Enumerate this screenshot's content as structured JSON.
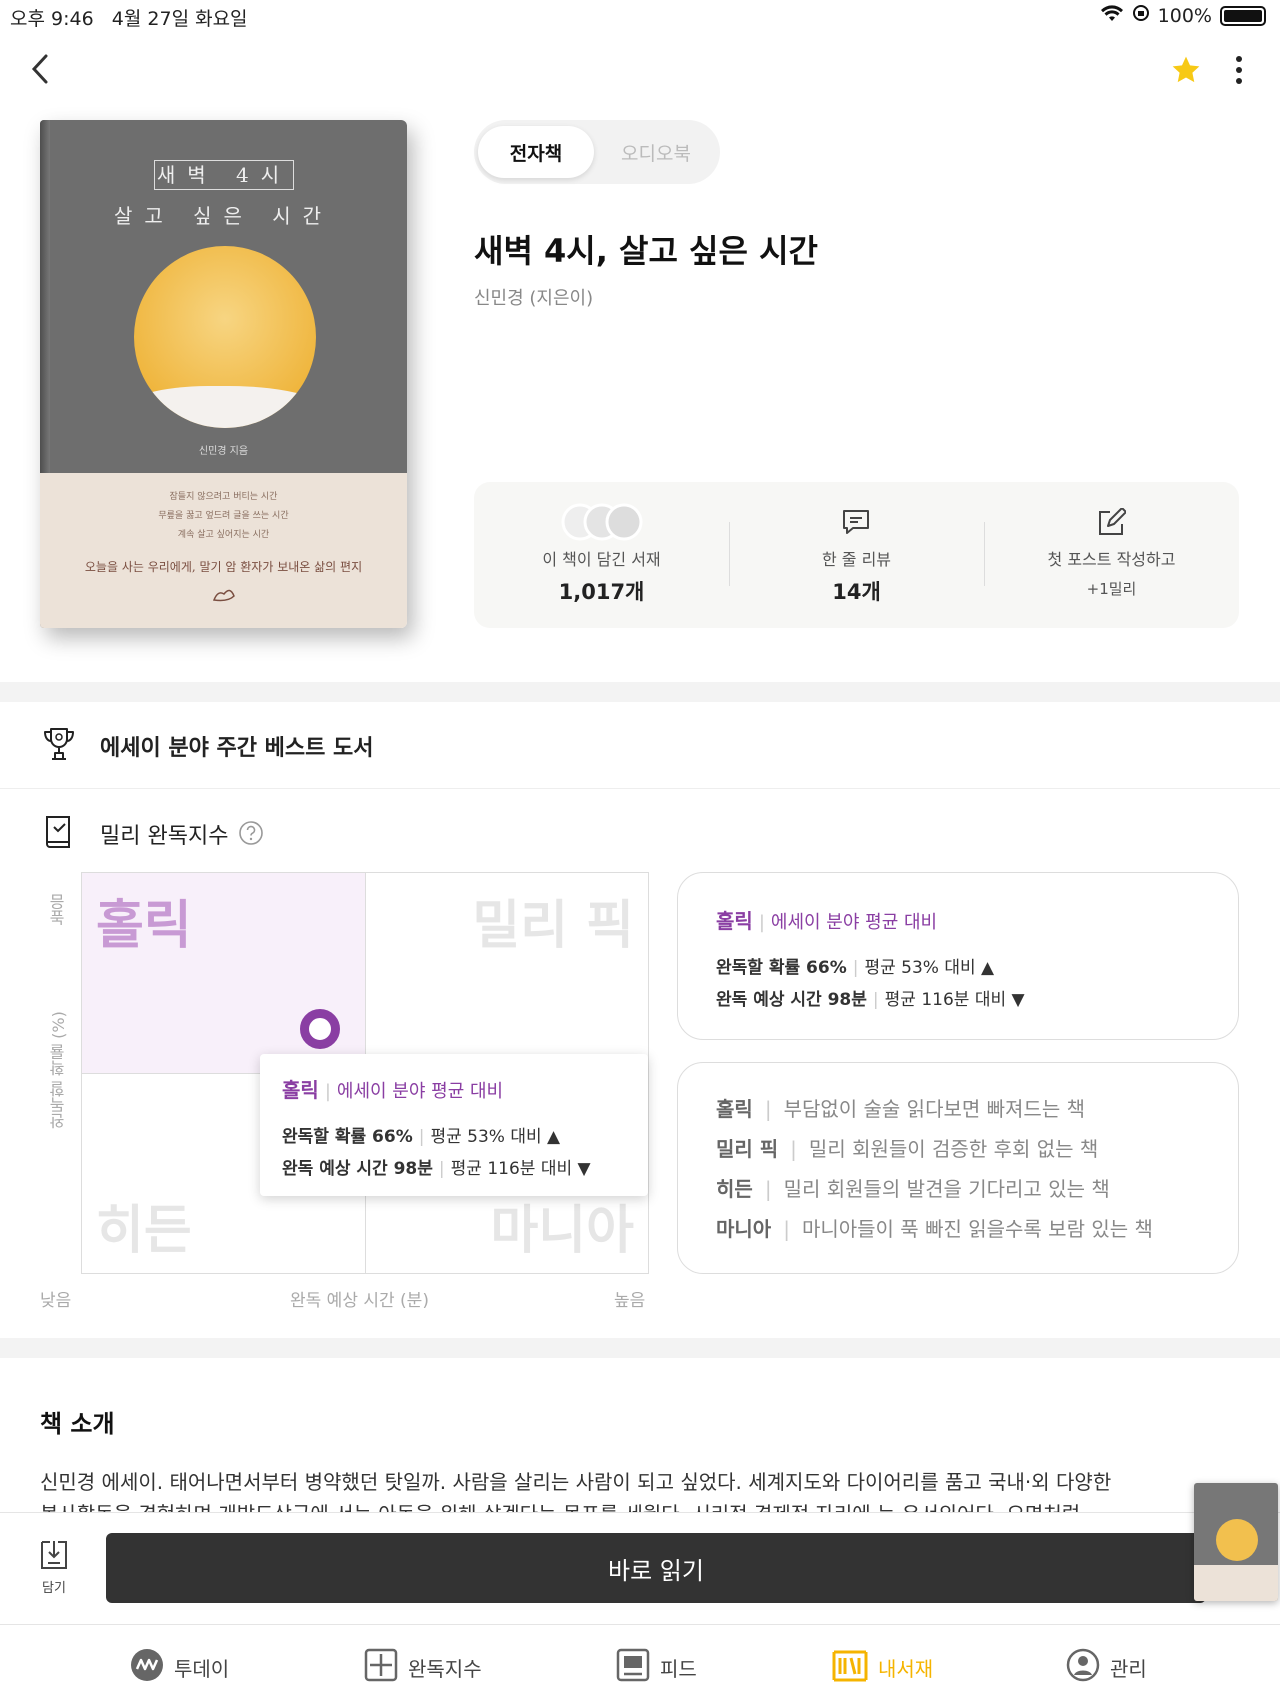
{
  "status_bar": {
    "time": "오후 9:46",
    "date": "4월 27일 화요일",
    "battery": "100%"
  },
  "cover": {
    "line1": "새벽 4시",
    "line2": "살고 싶은 시간",
    "author": "신민경 지음",
    "blurb1": "잠들지 않으려고 버티는 시간",
    "blurb2": "무릎을 꿇고 엎드려 글을 쓰는 시간",
    "blurb3": "계속 살고 싶어지는 시간",
    "tagline": "오늘을 사는 우리에게, 말기 암 환자가 보내온 삶의 편지"
  },
  "format_tabs": {
    "ebook": "전자책",
    "audiobook": "오디오북"
  },
  "book": {
    "title": "새벽 4시, 살고 싶은 시간",
    "author": "신민경 (지은이)"
  },
  "stats": {
    "shelves_label": "이 책이 담긴 서재",
    "shelves_value": "1,017개",
    "reviews_label": "한 줄 리뷰",
    "reviews_value": "14개",
    "post_label": "첫 포스트 작성하고",
    "post_reward": "+1밀리"
  },
  "bestseller": {
    "text": "에세이 분야 주간 베스트 도서"
  },
  "completion": {
    "title": "밀리 완독지수",
    "y_axis": "완독할 확률 (%)",
    "y_high": "높음",
    "x_axis": "완독 예상 시간 (분)",
    "x_low": "낮음",
    "x_high": "높음",
    "quadrants": {
      "top_left": "홀릭",
      "top_right": "밀리 픽",
      "bottom_left": "히든",
      "bottom_right": "마니아"
    },
    "tooltip": {
      "category": "홀릭",
      "compare": "에세이 분야 평균 대비",
      "prob_label": "완독할 확률 66%",
      "prob_avg": "평균 53% 대비",
      "time_label": "완독 예상 시간 98분",
      "time_avg": "평균 116분 대비"
    },
    "summary": {
      "category": "홀릭",
      "compare": "에세이 분야 평균 대비",
      "prob_label": "완독할 확률 66%",
      "prob_avg": "평균 53% 대비",
      "time_label": "완독 예상 시간 98분",
      "time_avg": "평균 116분 대비"
    },
    "legend": [
      {
        "name": "홀릭",
        "desc": "부담없이 술술 읽다보면 빠져드는 책"
      },
      {
        "name": "밀리 픽",
        "desc": "밀리 회원들이 검증한 후회 없는 책"
      },
      {
        "name": "히든",
        "desc": "밀리 회원들의 발견을 기다리고 있는 책"
      },
      {
        "name": "마니아",
        "desc": "마니아들이 푹 빠진 읽을수록 보람 있는 책"
      }
    ]
  },
  "intro": {
    "heading": "책 소개",
    "text": "신민경 에세이. 태어나면서부터 병약했던 탓일까. 사람을 살리는 사람이 되고 싶었다. 세계지도와 다이어리를 품고 국내·외 다양한",
    "text2": "봉사활동을 경험하며 개발도상국에 서는 아동을 위해 살겠다는 목표를 세웠다. 시리적 경제적 자리에 는 유서의어다. 오면처럼"
  },
  "actions": {
    "save": "담기",
    "read": "바로 읽기"
  },
  "nav": {
    "today": "투데이",
    "completion": "완독지수",
    "feed": "피드",
    "library": "내서재",
    "manage": "관리"
  },
  "colors": {
    "accent": "#8a3ea3",
    "nav_active": "#f5b400",
    "read_button": "#333333"
  }
}
